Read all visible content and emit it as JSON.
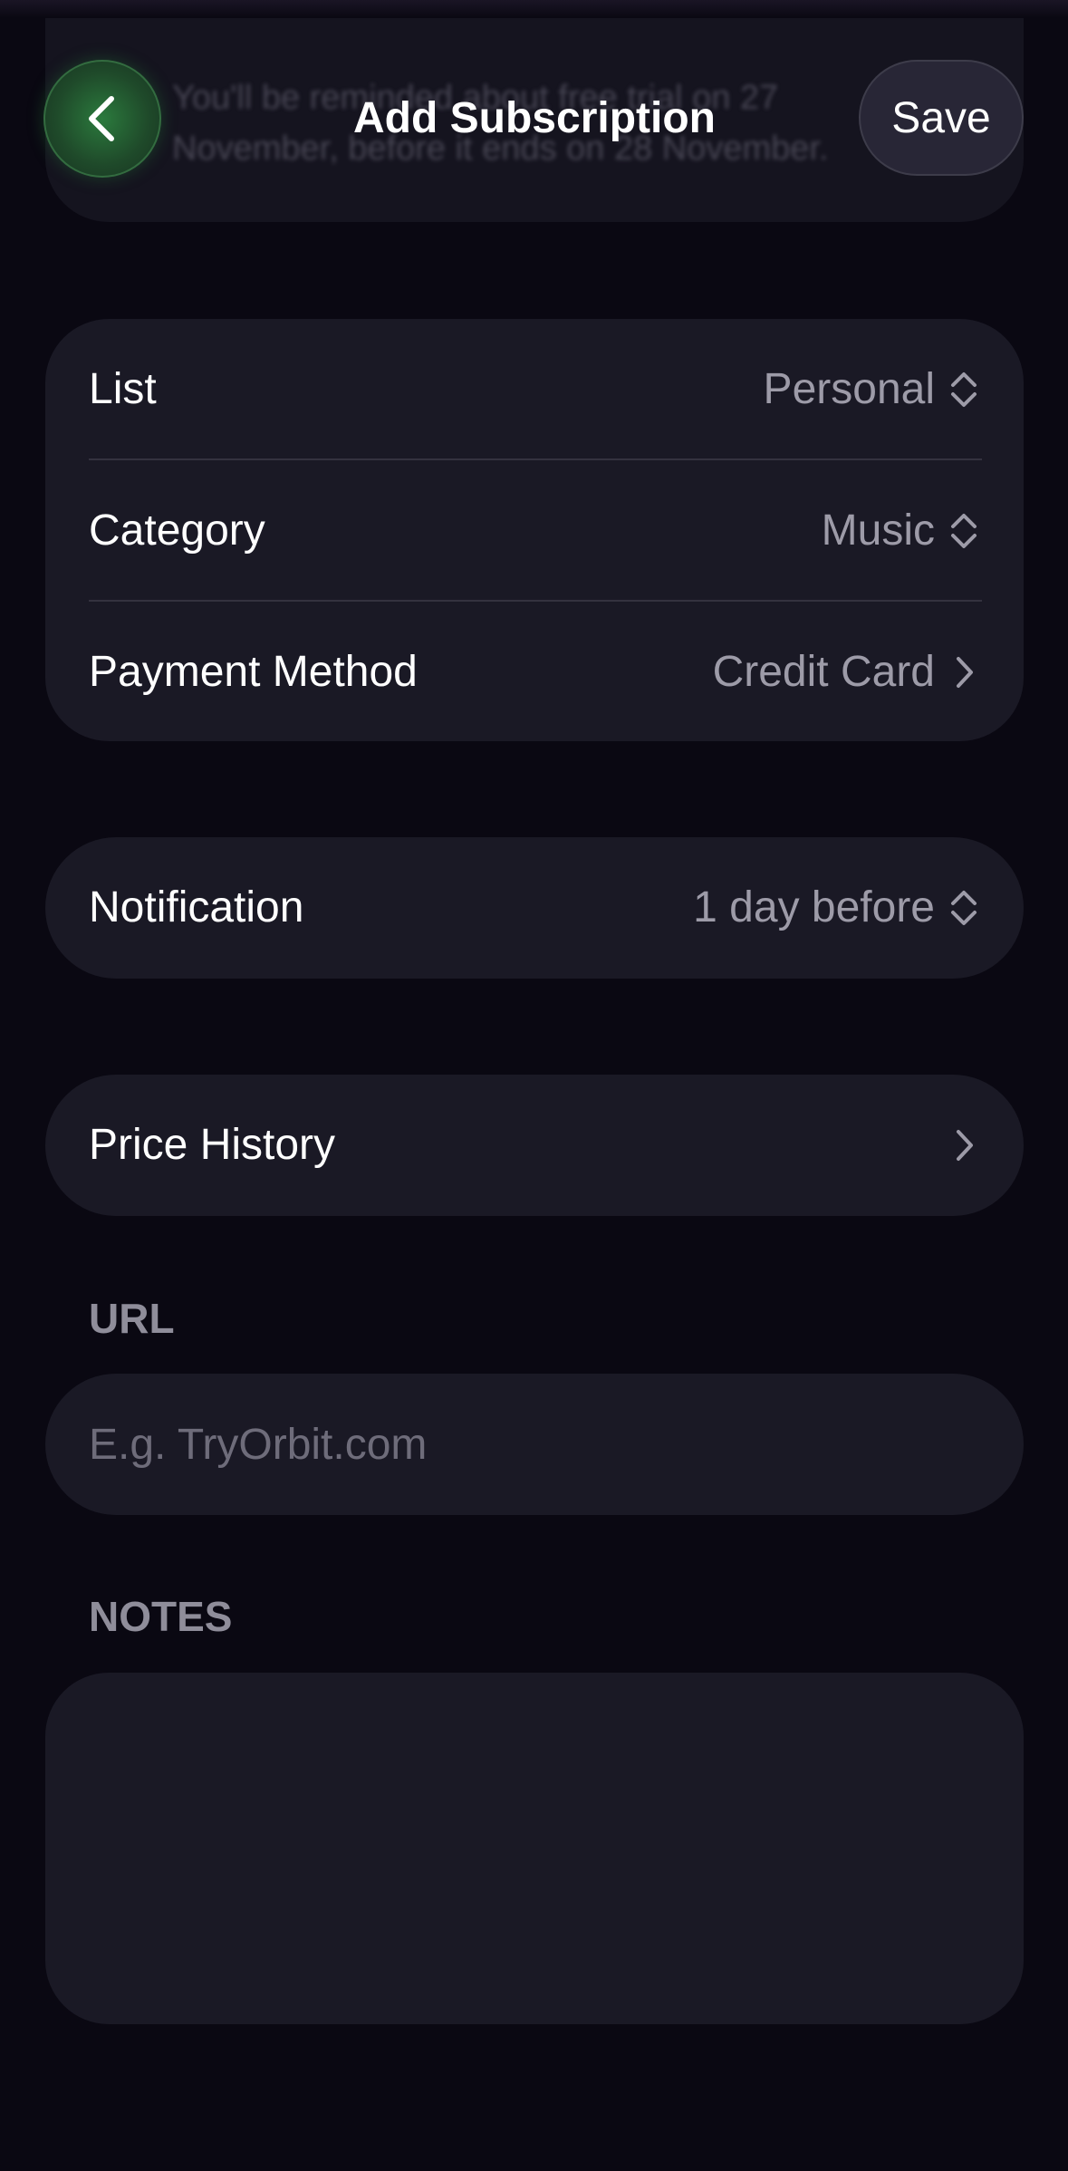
{
  "header": {
    "title": "Add Subscription",
    "save_label": "Save",
    "behind_text_line1": "You'll be reminded about free trial on 27",
    "behind_text_line2": "November, before it ends on 28 November."
  },
  "details": {
    "list": {
      "label": "List",
      "value": "Personal"
    },
    "category": {
      "label": "Category",
      "value": "Music"
    },
    "payment_method": {
      "label": "Payment Method",
      "value": "Credit Card"
    }
  },
  "notification": {
    "label": "Notification",
    "value": "1 day before"
  },
  "price_history": {
    "label": "Price History"
  },
  "url": {
    "section_label": "URL",
    "value": "",
    "placeholder": "E.g. TryOrbit.com"
  },
  "notes": {
    "section_label": "NOTES",
    "value": ""
  },
  "colors": {
    "background": "#0a0812",
    "card": "#1a1925",
    "accent_green": "#2b7a3d",
    "secondary_text": "#9d9ba8"
  }
}
